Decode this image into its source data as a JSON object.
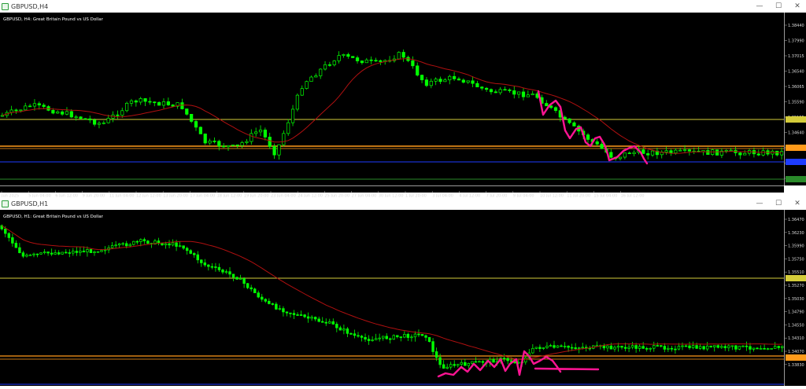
{
  "charts": [
    {
      "window_title": "GBPUSD,H4",
      "symbol_caption": "GBPUSD, H4:  Great Britain Pound vs US Dollar",
      "price_labels": [
        "1.38440",
        "1.37990",
        "1.37015",
        "1.36540",
        "1.36065",
        "1.35590",
        "1.35155",
        "1.34640",
        "1.34163",
        "1.33690",
        "1.33215"
      ],
      "time_labels": [
        "Jun 2025",
        "5 Jun 04:00",
        "6 Jun 12:00",
        "9 Jun 20:00",
        "11 Jun 04:00",
        "12 Jun 12:00",
        "13 Jun 20:00",
        "17 Jun 04:00",
        "18 Jun 12:00",
        "19 Jun 20:00",
        "23 Jun 04:00",
        "24 Jun 12:00",
        "25 Jun 20:00",
        "27 Jun 04:00",
        "30 Jun 12:00",
        "1 Jul 20:00",
        "3 Jul 04:00",
        "4 Jul 12:00",
        "7 Jul 20:00",
        "9 Jul 04:00",
        "10 Jul 12:00",
        "11 Jul 20:00",
        "15 Jul 04:00",
        "16 Jul 12:00"
      ]
    },
    {
      "window_title": "GBPUSD,H1",
      "symbol_caption": "GBPUSD, H1:  Great Britain Pound vs US Dollar",
      "price_labels": [
        "1.36470",
        "1.36230",
        "1.35990",
        "1.35750",
        "1.35510",
        "1.35270",
        "1.35030",
        "1.34790",
        "1.34550",
        "1.34310",
        "1.34070",
        "1.33830"
      ],
      "time_labels": []
    }
  ],
  "colors": {
    "background": "#000000",
    "candle": "#00ff00",
    "moving_average": "#b01010",
    "annotation": "#ff1493",
    "level_yellow": "#d4cc3a",
    "level_orange": "#ff9a1a",
    "level_blue": "#1e3cff",
    "level_green": "#2a8a2a"
  },
  "icons": {
    "window_icon": "chart-window-icon",
    "minimize": "minimize-icon",
    "maximize": "maximize-icon",
    "close": "close-icon"
  },
  "window_buttons": {
    "minimize": "—",
    "maximize": "☐",
    "close": "✕"
  }
}
